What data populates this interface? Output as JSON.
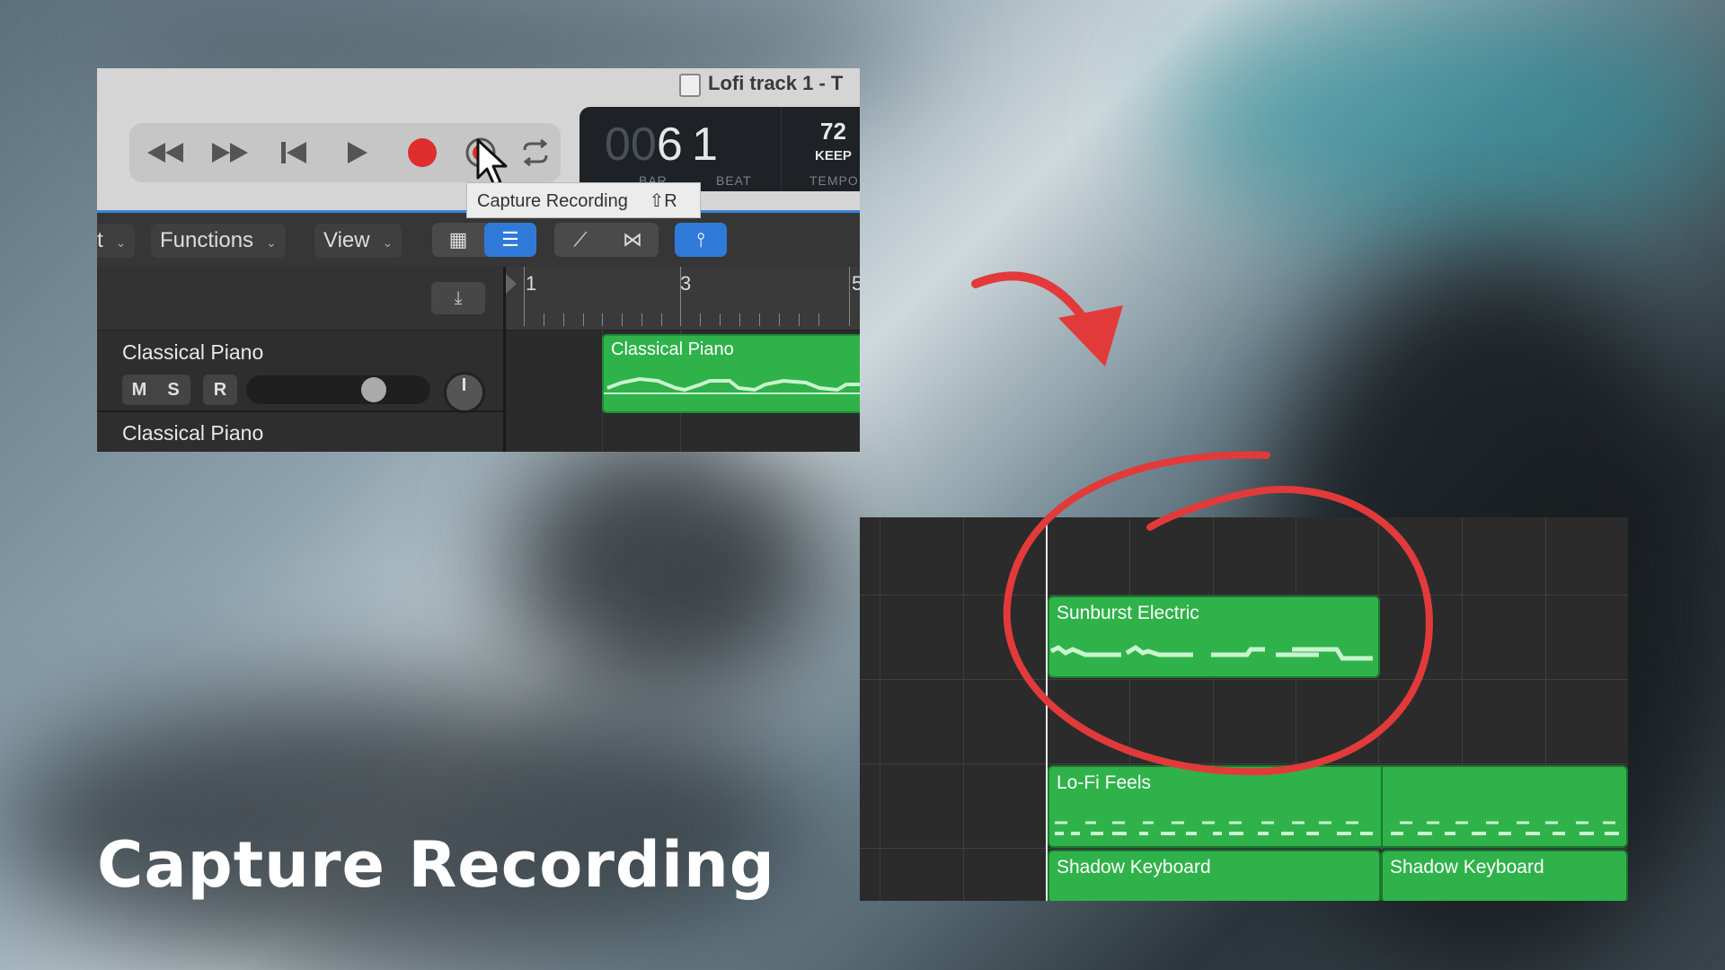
{
  "window": {
    "title": "Lofi track 1 - T"
  },
  "transport": {
    "buttons": [
      "rewind",
      "fast-forward",
      "go-to-start",
      "play",
      "record",
      "capture-recording",
      "cycle"
    ],
    "record_color": "#e02d2d"
  },
  "lcd": {
    "bar_dim": "00",
    "bar": "6",
    "beat": "1",
    "bar_label": "BAR",
    "beat_label": "BEAT",
    "tempo": "72",
    "keep_label": "KEEP",
    "tempo_label": "TEMPO"
  },
  "tooltip": {
    "text": "Capture Recording",
    "shortcut": "⇧R"
  },
  "toolbar": {
    "edit_partial": "t",
    "functions_label": "Functions",
    "view_label": "View"
  },
  "ruler": {
    "marks": [
      "1",
      "3",
      "5"
    ]
  },
  "tracks": [
    {
      "name": "Classical Piano",
      "mute": "M",
      "solo": "S",
      "record": "R"
    },
    {
      "name": "Classical Piano"
    }
  ],
  "top_region": {
    "label": "Classical Piano"
  },
  "arrange_regions": [
    {
      "label": "Sunburst Electric"
    },
    {
      "label": "Lo-Fi Feels"
    },
    {
      "label": "Shadow Keyboard"
    },
    {
      "label": "Shadow Keyboard"
    }
  ],
  "caption": "Capture Recording",
  "colors": {
    "region_green": "#2fb24a",
    "accent_blue": "#2f7ad8",
    "annotation_red": "#e23a3a"
  }
}
